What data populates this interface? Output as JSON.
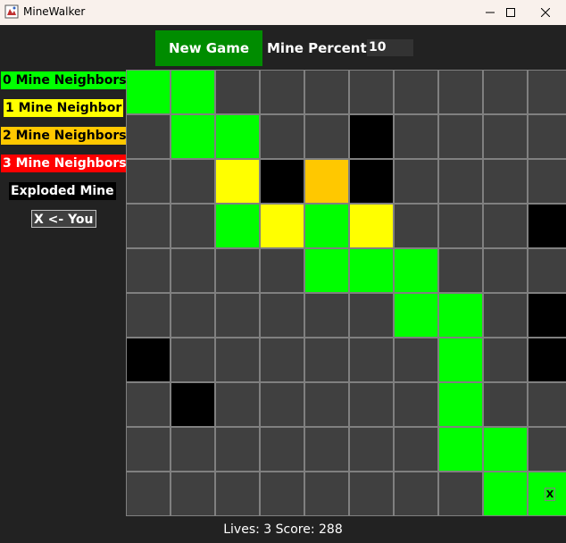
{
  "window": {
    "title": "MineWalker",
    "icon": "minewalker-app-icon",
    "controls": [
      "minimize-icon",
      "maximize-icon",
      "close-icon"
    ]
  },
  "toolbar": {
    "new_game_label": "New Game",
    "mine_percent_label": "Mine Percent:",
    "mine_percent_value": "10"
  },
  "legend": {
    "zero": "0 Mine Neighbors",
    "one": "1 Mine Neighbor",
    "two": "2 Mine Neighbors",
    "three": "3 Mine Neighbors",
    "exploded": "Exploded Mine",
    "you": "X <- You"
  },
  "colors": {
    "zero": "#00ff00",
    "one": "#ffff00",
    "two": "#ffc800",
    "three": "#ff0000",
    "exploded": "#000000",
    "unknown": "#404040",
    "grid": "#808080",
    "new_game": "#008c00",
    "background": "#222222"
  },
  "board": {
    "rows": 10,
    "cols": 10,
    "cells": [
      [
        "0",
        "0",
        "U",
        "U",
        "U",
        "U",
        "U",
        "U",
        "U",
        "U"
      ],
      [
        "U",
        "0",
        "0",
        "U",
        "U",
        "E",
        "U",
        "U",
        "U",
        "U"
      ],
      [
        "U",
        "U",
        "1",
        "E",
        "2",
        "E",
        "U",
        "U",
        "U",
        "U"
      ],
      [
        "U",
        "U",
        "0",
        "1",
        "0",
        "1",
        "U",
        "U",
        "U",
        "E"
      ],
      [
        "U",
        "U",
        "U",
        "U",
        "0",
        "0",
        "0",
        "U",
        "U",
        "U"
      ],
      [
        "U",
        "U",
        "U",
        "U",
        "U",
        "U",
        "0",
        "0",
        "U",
        "E"
      ],
      [
        "E",
        "U",
        "U",
        "U",
        "U",
        "U",
        "U",
        "0",
        "U",
        "E"
      ],
      [
        "U",
        "E",
        "U",
        "U",
        "U",
        "U",
        "U",
        "0",
        "U",
        "U"
      ],
      [
        "U",
        "U",
        "U",
        "U",
        "U",
        "U",
        "U",
        "0",
        "0",
        "U"
      ],
      [
        "U",
        "U",
        "U",
        "U",
        "U",
        "U",
        "U",
        "U",
        "0",
        "0"
      ]
    ],
    "player": {
      "row": 9,
      "col": 9,
      "marker": "X"
    }
  },
  "status": {
    "text": "Lives: 3 Score: 288"
  }
}
